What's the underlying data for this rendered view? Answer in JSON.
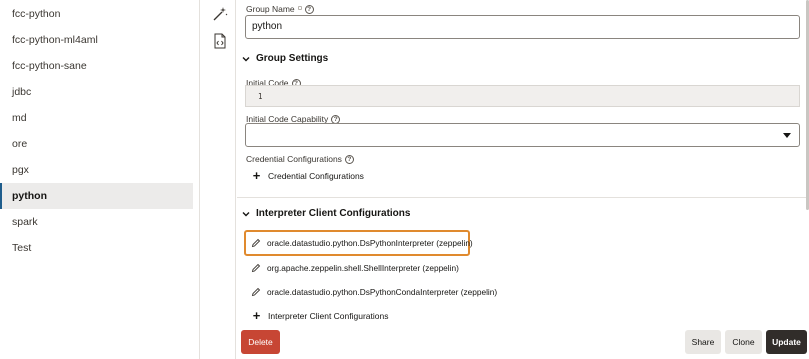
{
  "sidebar": {
    "items": [
      {
        "label": "fcc-python",
        "active": false
      },
      {
        "label": "fcc-python-ml4aml",
        "active": false
      },
      {
        "label": "fcc-python-sane",
        "active": false
      },
      {
        "label": "jdbc",
        "active": false
      },
      {
        "label": "md",
        "active": false
      },
      {
        "label": "ore",
        "active": false
      },
      {
        "label": "pgx",
        "active": false
      },
      {
        "label": "python",
        "active": true
      },
      {
        "label": "spark",
        "active": false
      },
      {
        "label": "Test",
        "active": false
      }
    ]
  },
  "rail": {
    "icons": [
      "magic-wand-icon",
      "code-file-icon"
    ]
  },
  "form": {
    "group_name_label": "Group Name",
    "group_name_value": "python",
    "group_settings_title": "Group Settings",
    "initial_code_label": "Initial Code",
    "initial_code_value": "1",
    "initial_code_capability_label": "Initial Code Capability",
    "initial_code_capability_value": "",
    "credential_configurations_label": "Credential Configurations",
    "add_credential_configurations": "Credential Configurations",
    "interpreter_section_title": "Interpreter Client Configurations",
    "interpreter_clients": [
      "oracle.datastudio.python.DsPythonInterpreter (zeppelin)",
      "org.apache.zeppelin.shell.ShellInterpreter (zeppelin)",
      "oracle.datastudio.python.DsPythonCondaInterpreter (zeppelin)"
    ],
    "add_interpreter_client": "Interpreter Client Configurations"
  },
  "footer": {
    "delete_label": "Delete",
    "share_label": "Share",
    "clone_label": "Clone",
    "update_label": "Update"
  },
  "colors": {
    "delete": "#c74634",
    "update": "#312d2a",
    "highlight": "#e08a2e",
    "active_marker": "#1f5d8c"
  }
}
